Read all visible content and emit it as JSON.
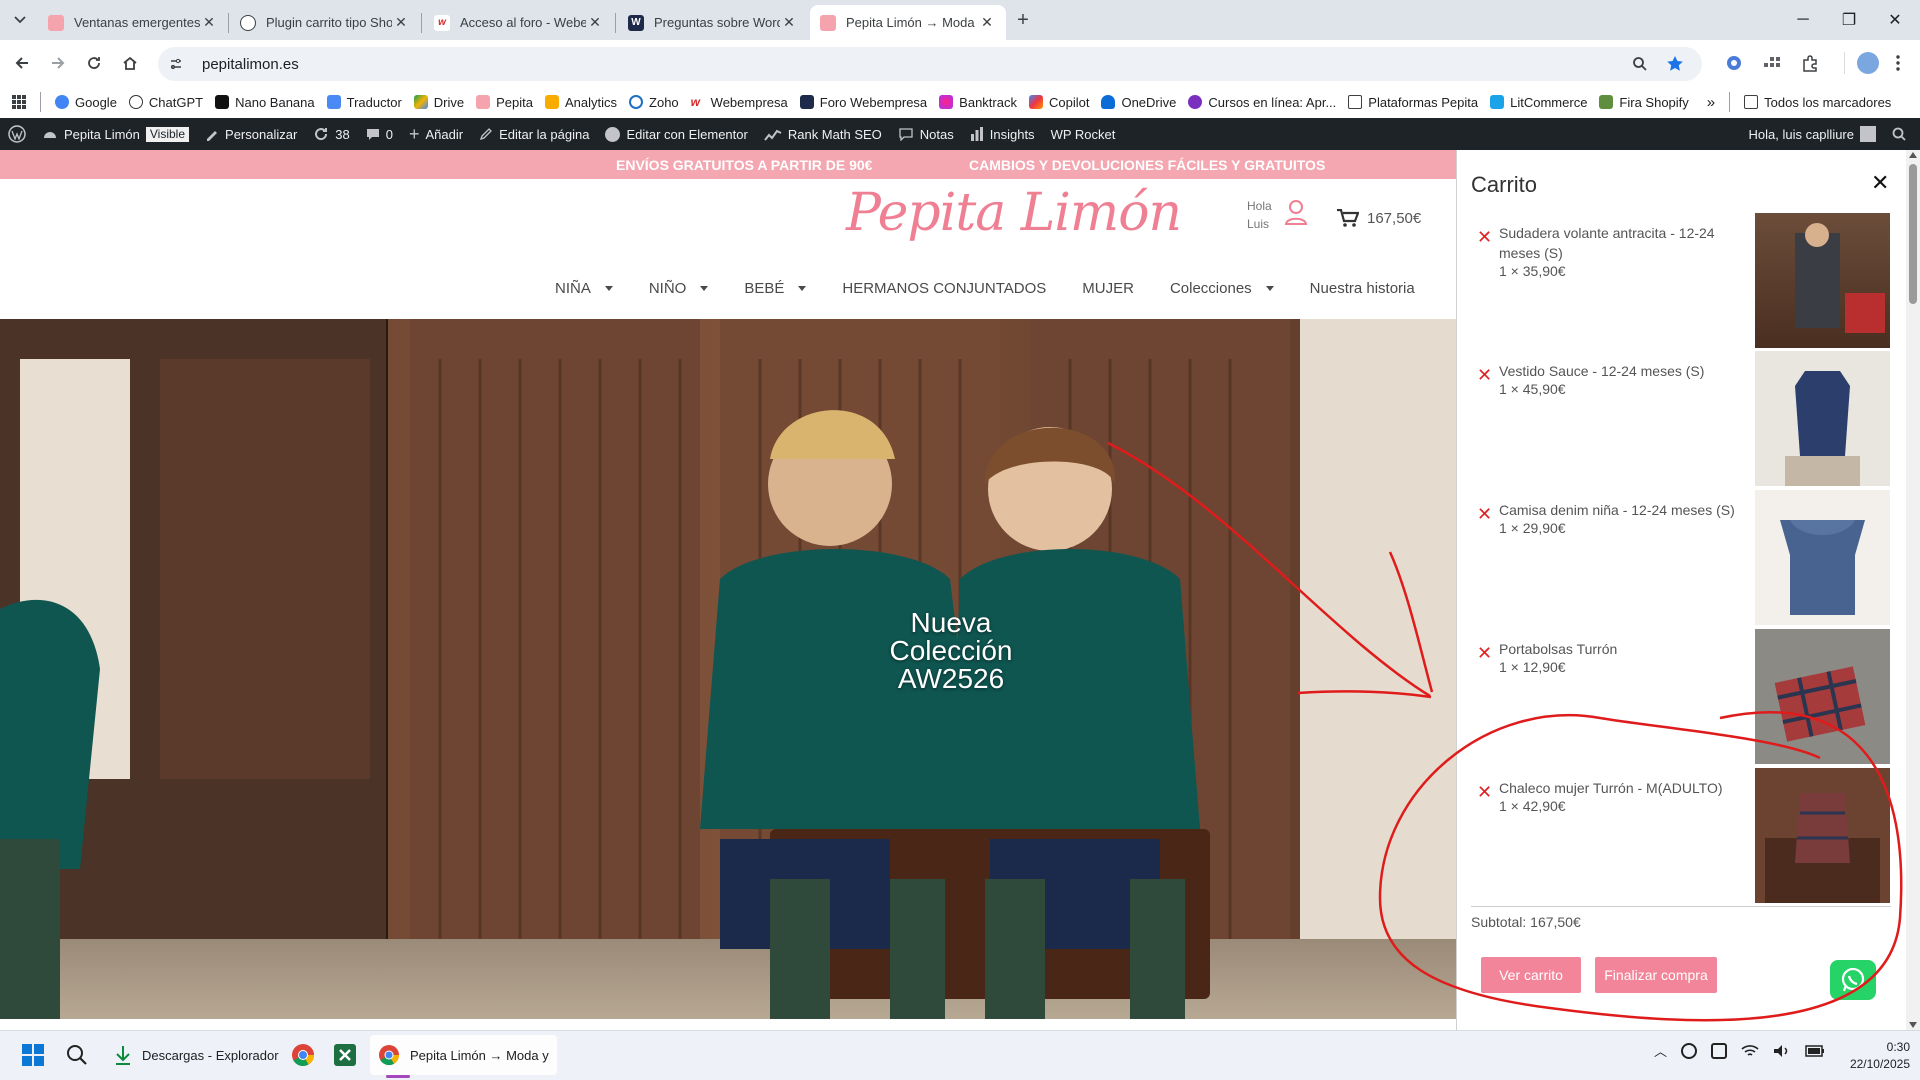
{
  "browser": {
    "tabs": [
      {
        "title": "Ventanas emergentes < Pepita",
        "active": false
      },
      {
        "title": "Plugin carrito tipo Shopify",
        "active": false
      },
      {
        "title": "Acceso al foro - Webempresa E",
        "active": false
      },
      {
        "title": "Preguntas sobre WordPress – ",
        "active": false
      },
      {
        "title": "Pepita Limón → Moda y ropa in",
        "active": true
      }
    ],
    "url": "pepitalimon.es",
    "bookmarks": [
      "Google",
      "ChatGPT",
      "Nano Banana",
      "Traductor",
      "Drive",
      "Pepita",
      "Analytics",
      "Zoho",
      "Webempresa",
      "Foro Webempresa",
      "Banktrack",
      "Copilot",
      "OneDrive",
      "Cursos en línea: Apr...",
      "Plataformas Pepita",
      "LitCommerce",
      "Fira Shopify"
    ],
    "all_bookmarks": "Todos los marcadores"
  },
  "wp_admin": {
    "site_name": "Pepita Limón",
    "visible_badge": "Visible",
    "customize": "Personalizar",
    "updates": "38",
    "comments": "0",
    "add_new": "Añadir",
    "edit_page": "Editar la página",
    "edit_elementor": "Editar con Elementor",
    "rank_math": "Rank Math SEO",
    "notes": "Notas",
    "insights": "Insights",
    "wp_rocket": "WP Rocket",
    "greeting": "Hola, luis caplliure"
  },
  "site": {
    "promo_left": "ENVÍOS GRATUITOS A PARTIR DE 90€",
    "promo_right": "CAMBIOS Y DEVOLUCIONES FÁCILES Y GRATUITOS",
    "logo": "Pepita Limón",
    "account_line1": "Hola",
    "account_line2": "Luis",
    "cart_total": "167,50€",
    "nav": [
      {
        "label": "NIÑA",
        "dropdown": true
      },
      {
        "label": "NIÑO",
        "dropdown": true
      },
      {
        "label": "BEBÉ",
        "dropdown": true
      },
      {
        "label": "HERMANOS CONJUNTADOS",
        "dropdown": false
      },
      {
        "label": "MUJER",
        "dropdown": false
      },
      {
        "label": "Colecciones",
        "dropdown": true
      },
      {
        "label": "Nuestra historia",
        "dropdown": false
      }
    ],
    "hero_line1": "Nueva Colección",
    "hero_line2": "AW2526"
  },
  "cart": {
    "title": "Carrito",
    "items": [
      {
        "name": "Sudadera volante antracita - 12-24 meses (S)",
        "qty_price": "1 × 35,90€"
      },
      {
        "name": "Vestido Sauce - 12-24 meses (S)",
        "qty_price": "1 × 45,90€"
      },
      {
        "name": "Camisa denim niña - 12-24 meses (S)",
        "qty_price": "1 × 29,90€"
      },
      {
        "name": "Portabolsas Turrón",
        "qty_price": "1 × 12,90€"
      },
      {
        "name": "Chaleco mujer Turrón - M(ADULTO)",
        "qty_price": "1 × 42,90€"
      }
    ],
    "subtotal": "Subtotal: 167,50€",
    "view_cart": "Ver carrito",
    "checkout": "Finalizar compra"
  },
  "taskbar": {
    "downloads": "Descargas - Explorador",
    "chrome_window": "Pepita Limón → Moda y",
    "time": "0:30",
    "date": "22/10/2025"
  },
  "colors": {
    "brand_pink": "#ef7f93",
    "promo_bg": "#f4a7b1",
    "button_pink": "#f2859a",
    "annotation_red": "#e01b1b"
  }
}
